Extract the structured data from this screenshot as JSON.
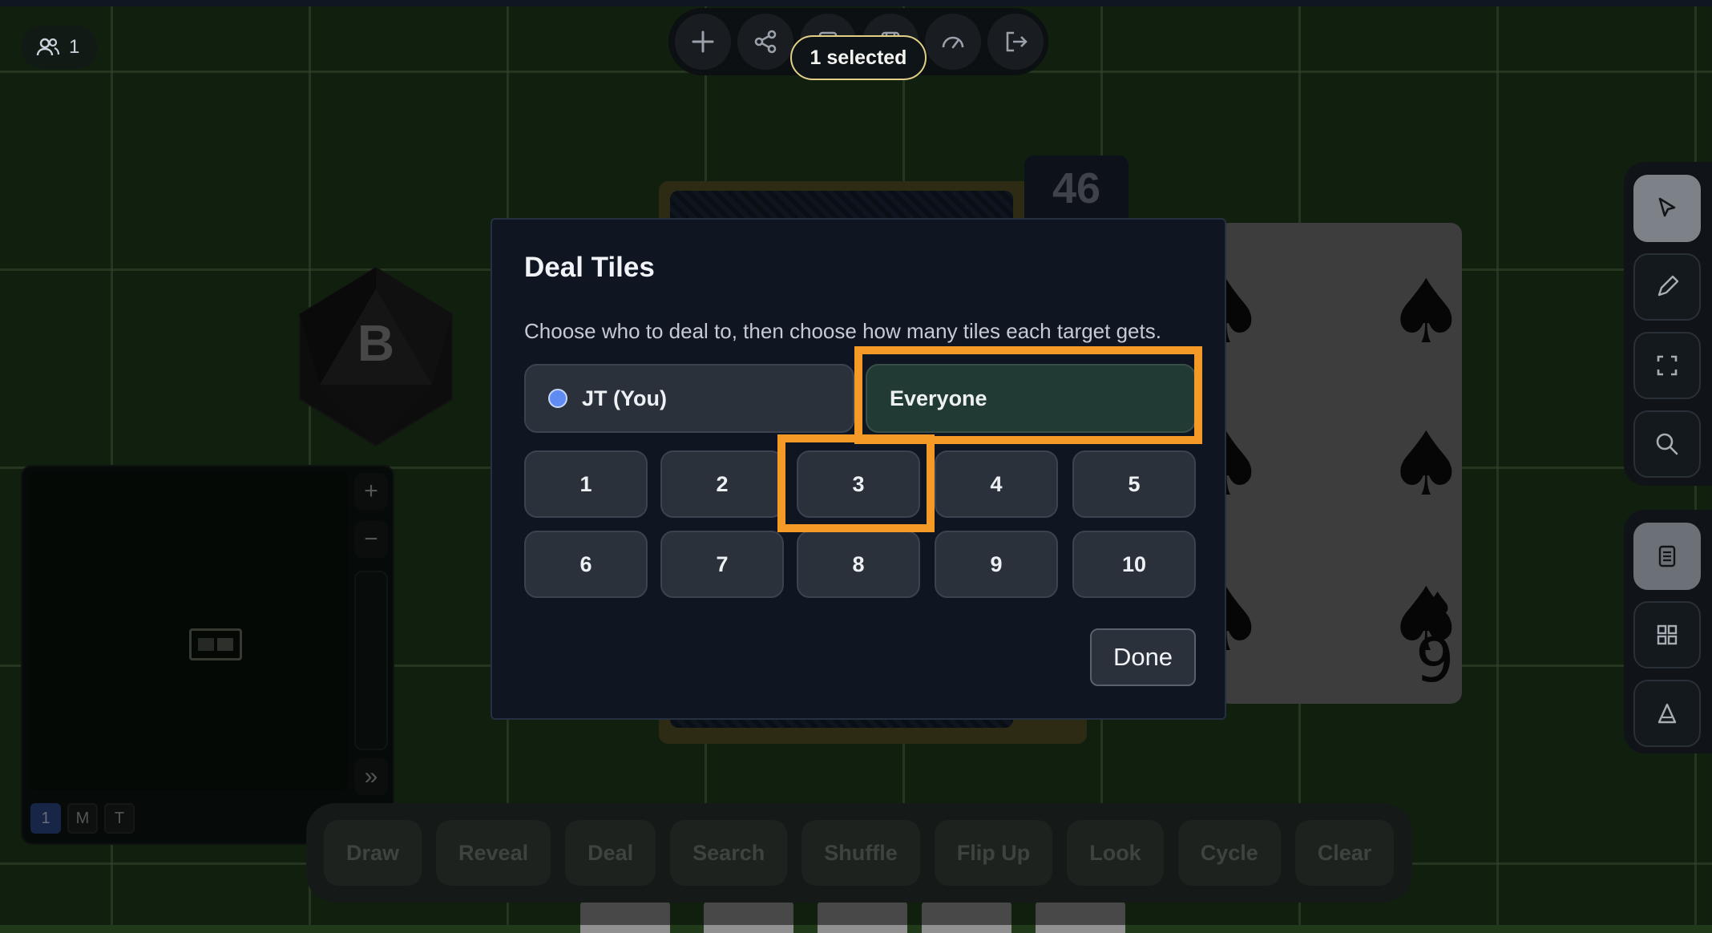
{
  "top_toolbar": {
    "players_count": "1",
    "icons": [
      "add-icon",
      "share-icon",
      "save-icon",
      "save-as-icon",
      "performance-icon",
      "exit-icon"
    ],
    "selected_label": "1 selected"
  },
  "table": {
    "deck_count": "46",
    "die_label": "B",
    "card_rank": "9",
    "card_suit": "♠"
  },
  "right_toolbar": {
    "top_group": [
      "pointer-icon",
      "pencil-icon",
      "fullscreen-icon",
      "search-icon"
    ],
    "bottom_group": [
      "notes-icon",
      "grid-icon",
      "text-icon"
    ]
  },
  "minimap": {
    "zoom_in": "+",
    "zoom_out": "−",
    "collapse": "»",
    "tabs": [
      "1",
      "M",
      "T"
    ]
  },
  "action_bar": {
    "buttons": [
      "Draw",
      "Reveal",
      "Deal",
      "Search",
      "Shuffle",
      "Flip Up",
      "Look",
      "Cycle",
      "Clear"
    ]
  },
  "dialog": {
    "title": "Deal Tiles",
    "description": "Choose who to deal to, then choose how many tiles each target gets.",
    "targets": [
      "JT (You)",
      "Everyone"
    ],
    "counts": [
      "1",
      "2",
      "3",
      "4",
      "5",
      "6",
      "7",
      "8",
      "9",
      "10"
    ],
    "done_label": "Done"
  },
  "colors": {
    "highlight": "#f59a26",
    "accent_blue": "#5e8cf2",
    "selected_border": "#e2cf86"
  }
}
